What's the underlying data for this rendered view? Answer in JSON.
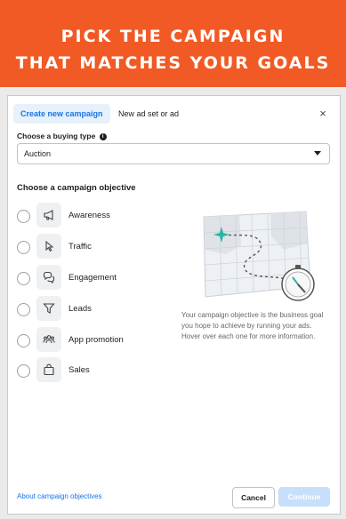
{
  "banner": {
    "line1": "PICK THE CAMPAIGN",
    "line2": "THAT MATCHES YOUR GOALS"
  },
  "tabs": [
    {
      "label": "Create new campaign",
      "active": true
    },
    {
      "label": "New ad set or ad",
      "active": false
    }
  ],
  "close_label": "×",
  "buying_type": {
    "label": "Choose a buying type",
    "info_icon": "i",
    "value": "Auction"
  },
  "objective": {
    "heading": "Choose a campaign objective",
    "options": [
      {
        "label": "Awareness",
        "icon": "megaphone-icon"
      },
      {
        "label": "Traffic",
        "icon": "cursor-icon"
      },
      {
        "label": "Engagement",
        "icon": "chat-bubbles-icon"
      },
      {
        "label": "Leads",
        "icon": "funnel-icon"
      },
      {
        "label": "App promotion",
        "icon": "people-icon"
      },
      {
        "label": "Sales",
        "icon": "shopping-bag-icon"
      }
    ],
    "description": "Your campaign objective is the business goal you hope to achieve by running your ads. Hover over each one for more information."
  },
  "footer": {
    "link": "About campaign objectives",
    "cancel": "Cancel",
    "continue": "Continue"
  },
  "colors": {
    "banner": "#f15a24",
    "accent": "#1b74e4",
    "continue_disabled": "#c6e0fb",
    "illustration_teal": "#2bb3a6"
  }
}
